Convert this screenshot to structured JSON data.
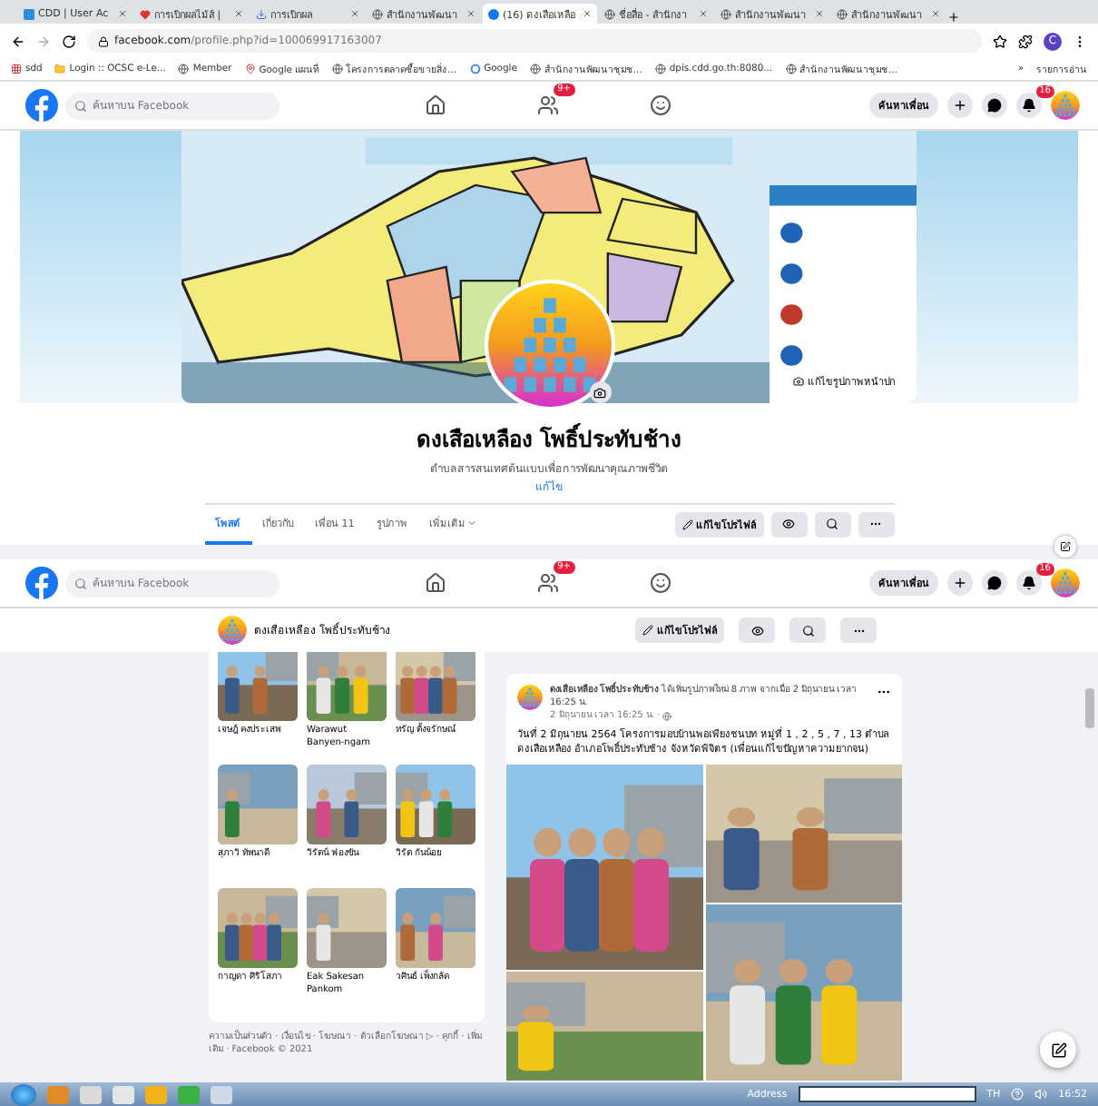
{
  "browser": {
    "tabs": [
      {
        "title": "CDD | User Ac",
        "selected": false
      },
      {
        "title": "การเบิกผลไม้ส์ |",
        "selected": false
      },
      {
        "title": "การเบิกผล",
        "selected": false
      },
      {
        "title": "สำนักงานพัฒนา",
        "selected": false
      },
      {
        "title": "(16) ดงเสือเหลือ",
        "selected": true
      },
      {
        "title": "ชื่อสื่อ - สำนักงา",
        "selected": false
      },
      {
        "title": "สำนักงานพัฒนา",
        "selected": false
      },
      {
        "title": "สำนักงานพัฒนา",
        "selected": false
      }
    ],
    "address": {
      "host": "facebook.com",
      "path": "/profile.php?id=100069917163007"
    },
    "profile_letter": "C",
    "bookmarks": [
      {
        "label": "sdd"
      },
      {
        "label": "Login :: OCSC e-Le..."
      },
      {
        "label": "Member"
      },
      {
        "label": "Google แผนที่"
      },
      {
        "label": "โครงการตลาดซื้อขายสิ่ง..."
      },
      {
        "label": "Google"
      },
      {
        "label": "สำนักงานพัฒนาชุมช..."
      },
      {
        "label": "dpis.cdd.go.th:8080..."
      },
      {
        "label": "สำนักงานพัฒนาชุมช..."
      }
    ],
    "more_bookmarks": "»",
    "reading_list": "รายการอ่าน"
  },
  "headers": [
    {
      "search_placeholder": "ค้นหาบน Facebook",
      "friends_badge": "9+",
      "find_friends": "ค้นหาเพื่อน",
      "notifications_badge": "16"
    },
    {
      "search_placeholder": "ค้นหาบน Facebook",
      "friends_badge": "9+",
      "find_friends": "ค้นหาเพื่อน",
      "notifications_badge": "16"
    }
  ],
  "profile": {
    "cover_button": "แก้ไขรูปภาพหน้าปก",
    "name": "ดงเสือเหลือง โพธิ์ประทับช้าง",
    "bio": "ตำบลสารสนเทศต้นแบบเพื่อการพัฒนาคุณภาพชีวิต",
    "edit_link": "แก้ไข",
    "tabs": [
      {
        "label": "โพสต์",
        "selected": true
      },
      {
        "label": "เกี่ยวกับ",
        "selected": false
      },
      {
        "label": "เพื่อน 11",
        "selected": false
      },
      {
        "label": "รูปภาพ",
        "selected": false
      },
      {
        "label": "เพิ่มเติม",
        "selected": false,
        "kind": "menu"
      }
    ],
    "edit_profile": "แก้ไขโปรไฟล์"
  },
  "sticky_bar": {
    "name": "ดงเสือเหลือง โพธิ์ประทับช้าง",
    "edit_profile": "แก้ไขโปรไฟล์"
  },
  "friends": [
    {
      "name": "เจษฎ์ คงประเสพ"
    },
    {
      "name": "Warawut Banyen-ngam"
    },
    {
      "name": "หรัญ ตั้งจรักษณ์"
    },
    {
      "name": "สุภาวิ ทัพนาดี"
    },
    {
      "name": "วิรัตน์ ฟองขัน"
    },
    {
      "name": "วิรัต กันน้อย"
    },
    {
      "name": "กาญดา ศิริโสภา"
    },
    {
      "name": "Eak Sakesan Pankom"
    },
    {
      "name": "วศินธ์ เพ็งกลัด"
    }
  ],
  "footer": "ความเป็นส่วนตัว · เงื่อนไข · โฆษณา · ตัวเลือกโฆษณา ▷ · คุกกี้ · เพิ่มเติม · Facebook © 2021",
  "post": {
    "author": "ดงเสือเหลือง โพธิ์ประทับช้าง",
    "action": "ได้เพิ่มรูปภาพใหม่ 8 ภาพ จากเมื่อ 2 มิถุนายน เวลา 16:25 น.",
    "time": "2 มิถุนายน เวลา 16:25 น. ·",
    "body": "วันที่ 2 มิถุนายน 2564 โครงการมอบบ้านพอเพียงชนบท หมู่ที่ 1 , 2 , 5 , 7 , 13 ตำบลดงเสือเหลือง อำเภอโพธิ์ประทับช้าง จังหวัดพิจิตร (เพื่อนแก้ไขปัญหาความยากจน)"
  },
  "taskbar": {
    "address_label": "Address",
    "language": "TH",
    "time": "16:52"
  }
}
